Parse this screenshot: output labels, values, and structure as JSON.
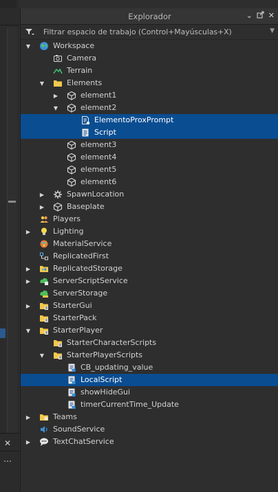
{
  "window": {
    "title": "Explorador"
  },
  "filter": {
    "placeholder": "Filtrar espacio de trabajo (Control+Mayúsculas+X)"
  },
  "tree": [
    {
      "label": "Workspace",
      "depth": 0,
      "arrow": "down",
      "icon": "globe-icon"
    },
    {
      "label": "Camera",
      "depth": 1,
      "arrow": "none",
      "icon": "camera-icon"
    },
    {
      "label": "Terrain",
      "depth": 1,
      "arrow": "none",
      "icon": "terrain-icon"
    },
    {
      "label": "Elements",
      "depth": 1,
      "arrow": "down",
      "icon": "folder-icon"
    },
    {
      "label": "element1",
      "depth": 2,
      "arrow": "right",
      "icon": "model-icon"
    },
    {
      "label": "element2",
      "depth": 2,
      "arrow": "down",
      "icon": "model-icon"
    },
    {
      "label": "ElementoProxPrompt",
      "depth": 3,
      "arrow": "none",
      "icon": "module-script-icon",
      "selected": true
    },
    {
      "label": "Script",
      "depth": 3,
      "arrow": "none",
      "icon": "script-icon",
      "selected": true
    },
    {
      "label": "element3",
      "depth": 2,
      "arrow": "none",
      "icon": "model-icon"
    },
    {
      "label": "element4",
      "depth": 2,
      "arrow": "none",
      "icon": "model-icon"
    },
    {
      "label": "element5",
      "depth": 2,
      "arrow": "none",
      "icon": "model-icon"
    },
    {
      "label": "element6",
      "depth": 2,
      "arrow": "none",
      "icon": "model-icon"
    },
    {
      "label": "SpawnLocation",
      "depth": 1,
      "arrow": "right",
      "icon": "spawn-icon"
    },
    {
      "label": "Baseplate",
      "depth": 1,
      "arrow": "right",
      "icon": "model-icon"
    },
    {
      "label": "Players",
      "depth": 0,
      "arrow": "none",
      "icon": "players-icon"
    },
    {
      "label": "Lighting",
      "depth": 0,
      "arrow": "right",
      "icon": "lightbulb-icon"
    },
    {
      "label": "MaterialService",
      "depth": 0,
      "arrow": "none",
      "icon": "material-service-icon"
    },
    {
      "label": "ReplicatedFirst",
      "depth": 0,
      "arrow": "none",
      "icon": "replicated-first-icon"
    },
    {
      "label": "ReplicatedStorage",
      "depth": 0,
      "arrow": "right",
      "icon": "replicated-storage-icon"
    },
    {
      "label": "ServerScriptService",
      "depth": 0,
      "arrow": "right",
      "icon": "server-script-service-icon"
    },
    {
      "label": "ServerStorage",
      "depth": 0,
      "arrow": "none",
      "icon": "server-storage-icon"
    },
    {
      "label": "StarterGui",
      "depth": 0,
      "arrow": "right",
      "icon": "starter-folder-icon"
    },
    {
      "label": "StarterPack",
      "depth": 0,
      "arrow": "none",
      "icon": "starter-folder-icon"
    },
    {
      "label": "StarterPlayer",
      "depth": 0,
      "arrow": "down",
      "icon": "starter-folder-icon"
    },
    {
      "label": "StarterCharacterScripts",
      "depth": 1,
      "arrow": "none",
      "icon": "starter-folder-icon"
    },
    {
      "label": "StarterPlayerScripts",
      "depth": 1,
      "arrow": "down",
      "icon": "starter-folder-icon"
    },
    {
      "label": "CB_updating_value",
      "depth": 2,
      "arrow": "none",
      "icon": "local-script-icon"
    },
    {
      "label": "LocalScript",
      "depth": 2,
      "arrow": "none",
      "icon": "local-script-icon",
      "selected": true
    },
    {
      "label": "showHideGui",
      "depth": 2,
      "arrow": "none",
      "icon": "local-script-icon"
    },
    {
      "label": "timerCurrentTime_Update",
      "depth": 2,
      "arrow": "none",
      "icon": "local-script-icon"
    },
    {
      "label": "Teams",
      "depth": 0,
      "arrow": "right",
      "icon": "teams-icon"
    },
    {
      "label": "SoundService",
      "depth": 0,
      "arrow": "none",
      "icon": "sound-icon"
    },
    {
      "label": "TextChatService",
      "depth": 0,
      "arrow": "right",
      "icon": "chat-icon"
    }
  ],
  "colors": {
    "selection": "#0a4d91",
    "panel": "#2e2e2e",
    "folder": "#f2c94c"
  }
}
